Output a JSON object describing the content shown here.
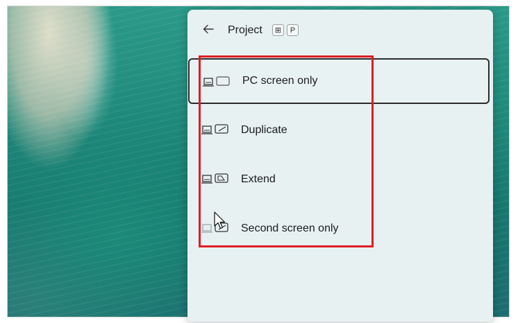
{
  "panel": {
    "title": "Project",
    "back_icon": "arrow-left-icon",
    "shortcut_keys": [
      "⊞",
      "P"
    ]
  },
  "options": [
    {
      "label": "PC screen only",
      "icon": "pc-screen-only-icon",
      "selected": true
    },
    {
      "label": "Duplicate",
      "icon": "duplicate-icon",
      "selected": false
    },
    {
      "label": "Extend",
      "icon": "extend-icon",
      "selected": false
    },
    {
      "label": "Second screen only",
      "icon": "second-screen-only-icon",
      "selected": false
    }
  ],
  "colors": {
    "highlight": "#e01c24",
    "panel_bg": "#e7f1f2",
    "text": "#1b1b1b"
  }
}
